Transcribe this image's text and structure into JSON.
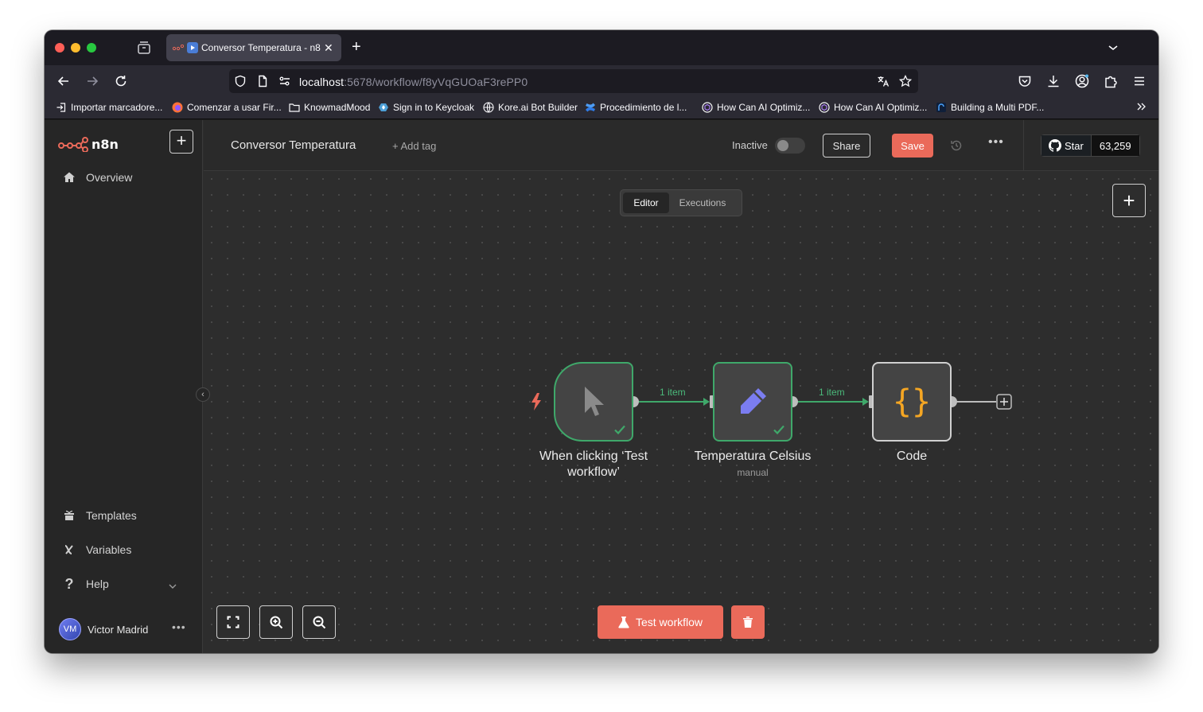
{
  "browser": {
    "tab": {
      "title": "Conversor Temperatura - n8n"
    },
    "url": {
      "host": "localhost",
      "path": ":5678/workflow/f8yVqGUOaF3rePP0"
    },
    "bookmarks": [
      "Importar marcadore...",
      "Comenzar a usar Fir...",
      "KnowmadMood",
      "Sign in to Keycloak",
      "Kore.ai Bot Builder",
      "Procedimiento de l...",
      "How Can AI Optimiz...",
      "How Can AI Optimiz...",
      "Building a Multi PDF..."
    ]
  },
  "sidebar": {
    "logo": "n8n",
    "items": {
      "overview": "Overview",
      "templates": "Templates",
      "variables": "Variables",
      "help": "Help"
    },
    "user": {
      "initials": "VM",
      "name": "Victor Madrid"
    }
  },
  "header": {
    "workflow_name": "Conversor Temperatura",
    "add_tag": "+ Add tag",
    "status": "Inactive",
    "share": "Share",
    "save": "Save",
    "github": {
      "star": "Star",
      "count": "63,259"
    },
    "modes": {
      "editor": "Editor",
      "executions": "Executions"
    }
  },
  "canvas": {
    "nodes": {
      "trigger": {
        "label": "When clicking ‘Test workflow’",
        "status": "success"
      },
      "set": {
        "label": "Temperatura Celsius",
        "subtitle": "manual",
        "status": "success"
      },
      "code": {
        "label": "Code"
      }
    },
    "connections": {
      "trigger_to_set": "1 item",
      "set_to_code": "1 item"
    },
    "test_button": "Test workflow"
  },
  "colors": {
    "accent": "#ea6a5a",
    "success": "#3fa86a",
    "set_icon": "#7b7df0",
    "code_icon": "#f5a623",
    "trigger_bolt": "#ea6a5a"
  }
}
